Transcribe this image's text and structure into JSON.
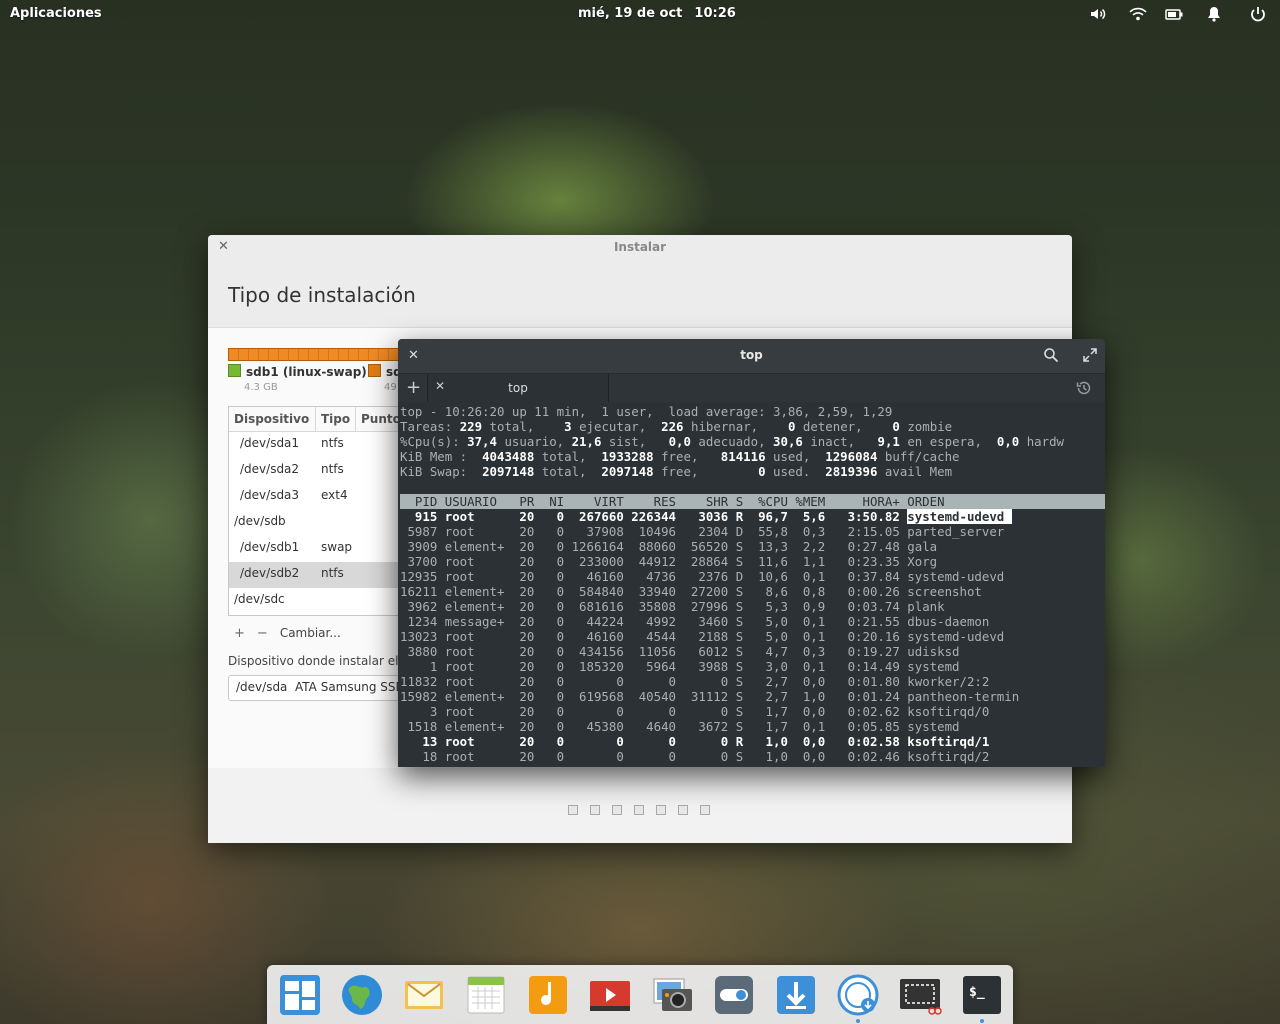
{
  "panel": {
    "apps_label": "Aplicaciones",
    "date": "mié, 19 de oct",
    "time": "10:26",
    "indicators": [
      "volume-icon",
      "wifi-icon",
      "battery-icon",
      "notifications-icon",
      "power-icon"
    ]
  },
  "installer": {
    "window_title": "Instalar",
    "heading": "Tipo de instalación",
    "partition_bar_color": "#f08a24",
    "legend": [
      {
        "label": "sdb1 (linux-swap)",
        "size": "4.3 GB",
        "color": "#78b832"
      },
      {
        "label": "sd",
        "size": "49",
        "color": "#e27d14"
      }
    ],
    "table": {
      "headers": [
        "Dispositivo",
        "Tipo",
        "Punto"
      ],
      "rows": [
        {
          "device": "/dev/sda1",
          "type": "ntfs"
        },
        {
          "device": "/dev/sda2",
          "type": "ntfs"
        },
        {
          "device": "/dev/sda3",
          "type": "ext4"
        },
        {
          "device": "/dev/sdb",
          "type": ""
        },
        {
          "device": "/dev/sdb1",
          "type": "swap"
        },
        {
          "device": "/dev/sdb2",
          "type": "ntfs"
        },
        {
          "device": "/dev/sdc",
          "type": ""
        }
      ]
    },
    "add_label": "+",
    "remove_label": "−",
    "change_label": "Cambiar...",
    "bootloader_label": "Dispositivo donde instalar el ca",
    "bootloader_device": "/dev/sda",
    "bootloader_model": "ATA Samsung SSD",
    "page_dots": 7
  },
  "terminal": {
    "window_title": "top",
    "tab_label": "top",
    "summary": [
      "top - 10:26:20 up 11 min,  1 user,  load average: 3,86, 2,59, 1,29",
      [
        "Tareas: ",
        "229",
        " total,    ",
        "3",
        " ejecutar,  ",
        "226",
        " hibernar,    ",
        "0",
        " detener,    ",
        "0",
        " zombie"
      ],
      [
        "%Cpu(s): ",
        "37,4",
        " usuario, ",
        "21,6",
        " sist,   ",
        "0,0",
        " adecuado, ",
        "30,6",
        " inact,   ",
        "9,1",
        " en espera,  ",
        "0,0",
        " hardw"
      ],
      [
        "KiB Mem :  ",
        "4043488",
        " total,  ",
        "1933288",
        " free,   ",
        "814116",
        " used,  ",
        "1296084",
        " buff/cache"
      ],
      [
        "KiB Swap:  ",
        "2097148",
        " total,  ",
        "2097148",
        " free,        ",
        "0",
        " used.  ",
        "2819396",
        " avail Mem"
      ]
    ],
    "header": "  PID USUARIO   PR  NI    VIRT    RES    SHR S  %CPU %MEM     HORA+ ORDEN",
    "processes": [
      {
        "text": "  915 root      20   0  267660 226344   3036 R  96,7  5,6   3:50.82 ",
        "cmd": "systemd-udevd ",
        "bold": true,
        "cursor": true
      },
      {
        "text": " 5987 root      20   0   37908  10496   2304 D  55,8  0,3   2:15.05 ",
        "cmd": "parted_server"
      },
      {
        "text": " 3909 element+  20   0 1266164  88060  56520 S  13,3  2,2   0:27.48 ",
        "cmd": "gala"
      },
      {
        "text": " 3700 root      20   0  233000  44912  28864 S  11,6  1,1   0:23.35 ",
        "cmd": "Xorg"
      },
      {
        "text": "12935 root      20   0   46160   4736   2376 D  10,6  0,1   0:37.84 ",
        "cmd": "systemd-udevd"
      },
      {
        "text": "16211 element+  20   0  584840  33940  27200 S   8,6  0,8   0:00.26 ",
        "cmd": "screenshot"
      },
      {
        "text": " 3962 element+  20   0  681616  35808  27996 S   5,3  0,9   0:03.74 ",
        "cmd": "plank"
      },
      {
        "text": " 1234 message+  20   0   44224   4992   3460 S   5,0  0,1   0:21.55 ",
        "cmd": "dbus-daemon"
      },
      {
        "text": "13023 root      20   0   46160   4544   2188 S   5,0  0,1   0:20.16 ",
        "cmd": "systemd-udevd"
      },
      {
        "text": " 3880 root      20   0  434156  11056   6012 S   4,7  0,3   0:19.27 ",
        "cmd": "udisksd"
      },
      {
        "text": "    1 root      20   0  185320   5964   3988 S   3,0  0,1   0:14.49 ",
        "cmd": "systemd"
      },
      {
        "text": "11832 root      20   0       0      0      0 S   2,7  0,0   0:01.80 ",
        "cmd": "kworker/2:2"
      },
      {
        "text": "15982 element+  20   0  619568  40540  31112 S   2,7  1,0   0:01.24 ",
        "cmd": "pantheon-termin"
      },
      {
        "text": "    3 root      20   0       0      0      0 S   1,7  0,0   0:02.62 ",
        "cmd": "ksoftirqd/0"
      },
      {
        "text": " 1518 element+  20   0   45380   4640   3672 S   1,7  0,1   0:05.85 ",
        "cmd": "systemd"
      },
      {
        "text": "   13 root      20   0       0      0      0 R   1,0  0,0   0:02.58 ",
        "cmd": "ksoftirqd/1",
        "bold": true
      },
      {
        "text": "   18 root      20   0       0      0      0 S   1,0  0,0   0:02.46 ",
        "cmd": "ksoftirqd/2"
      }
    ]
  },
  "dock": {
    "items": [
      "multitasking-view-icon",
      "web-browser-icon",
      "mail-icon",
      "calendar-icon",
      "music-icon",
      "videos-icon",
      "photos-icon",
      "system-settings-icon",
      "appcenter-icon",
      "installer-icon",
      "screenshot-icon",
      "terminal-icon"
    ],
    "terminal_glyph": "$_"
  }
}
